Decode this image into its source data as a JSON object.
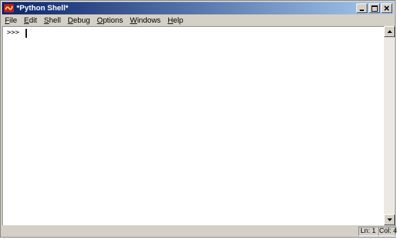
{
  "window": {
    "title": "*Python Shell*",
    "icon": "idle-python-icon",
    "controls": [
      "minimize-icon",
      "maximize-icon",
      "close-icon"
    ]
  },
  "menu": [
    {
      "id": "file",
      "label": "File"
    },
    {
      "id": "edit",
      "label": "Edit"
    },
    {
      "id": "shell",
      "label": "Shell"
    },
    {
      "id": "debug",
      "label": "Debug"
    },
    {
      "id": "options",
      "label": "Options"
    },
    {
      "id": "windows",
      "label": "Windows"
    },
    {
      "id": "help",
      "label": "Help"
    }
  ],
  "editor": {
    "prompt": ">>>"
  },
  "status": {
    "ln": "Ln: 1",
    "col": "Col: 4"
  },
  "colors": {
    "title_start": "#0a246a",
    "title_end": "#a6caf0",
    "chrome": "#d4d0c8"
  }
}
